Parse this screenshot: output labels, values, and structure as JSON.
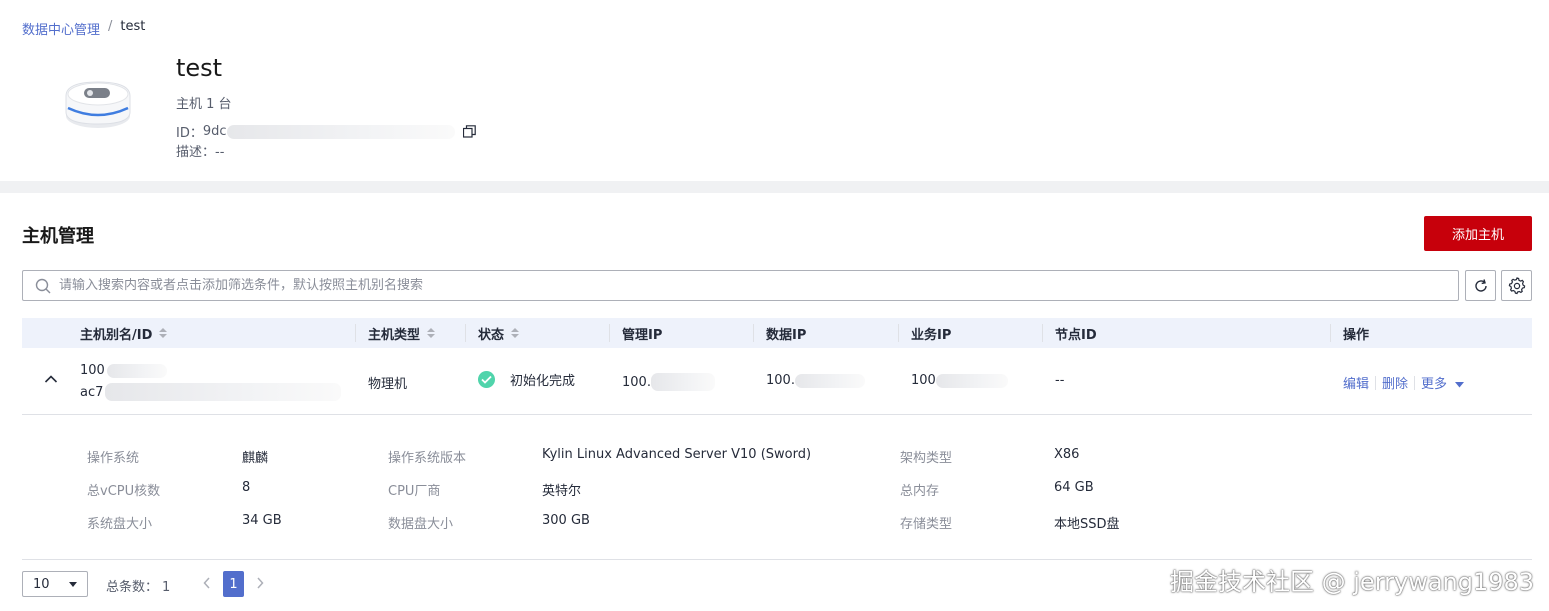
{
  "breadcrumb": {
    "parent": "数据中心管理",
    "separator": "/",
    "current": "test"
  },
  "datacenter": {
    "name": "test",
    "host_count": "主机 1 台",
    "id_label": "ID：",
    "id_value": "9dc",
    "desc_label": "描述：",
    "desc_value": "--"
  },
  "hosts": {
    "title": "主机管理",
    "add_button": "添加主机",
    "search_placeholder": "请输入搜索内容或者点击添加筛选条件，默认按照主机别名搜索",
    "columns": [
      "主机别名/ID",
      "主机类型",
      "状态",
      "管理IP",
      "数据IP",
      "业务IP",
      "节点ID",
      "操作"
    ],
    "row": {
      "alias": "100",
      "id": "ac7",
      "type": "物理机",
      "status": "初始化完成",
      "mgmt_ip": "100.",
      "data_ip": "100.",
      "biz_ip": "100",
      "node_id": "--",
      "actions": {
        "edit": "编辑",
        "delete": "删除",
        "more": "更多"
      }
    },
    "details": [
      {
        "label": "操作系统",
        "value": "麒麟"
      },
      {
        "label": "操作系统版本",
        "value": "Kylin Linux Advanced Server V10 (Sword)"
      },
      {
        "label": "架构类型",
        "value": "X86"
      },
      {
        "label": "总vCPU核数",
        "value": "8"
      },
      {
        "label": "CPU厂商",
        "value": "英特尔"
      },
      {
        "label": "总内存",
        "value": "64 GB"
      },
      {
        "label": "系统盘大小",
        "value": "34 GB"
      },
      {
        "label": "数据盘大小",
        "value": "300 GB"
      },
      {
        "label": "存储类型",
        "value": "本地SSD盘"
      }
    ]
  },
  "pagination": {
    "page_size": "10",
    "total_label": "总条数：",
    "total": "1",
    "current_page": "1"
  },
  "watermark": "掘金技术社区 @ jerrywang1983",
  "colors": {
    "primary": "#c7000b",
    "link": "#526ecc",
    "success": "#50d4ab",
    "header_bg": "#eef2fb"
  }
}
